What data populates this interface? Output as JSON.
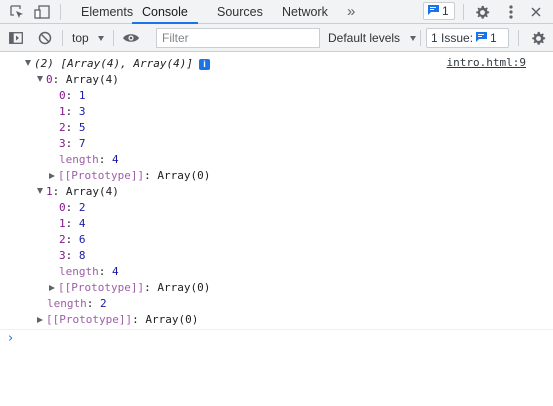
{
  "topbar": {
    "tabs": [
      {
        "label": "Elements",
        "active": false
      },
      {
        "label": "Console",
        "active": true
      },
      {
        "label": "Sources",
        "active": false
      },
      {
        "label": "Network",
        "active": false
      }
    ],
    "more_tabs_glyph": "»",
    "messages_count": "1",
    "icons": [
      "inspect-element-icon",
      "device-toggle-icon",
      "more-tabs-icon",
      "message-icon",
      "settings-icon",
      "kebab-menu-icon"
    ]
  },
  "toolbar": {
    "context": "top",
    "filter_placeholder": "Filter",
    "levels": "Default levels",
    "issues_label": "1 Issue:",
    "issues_count": "1"
  },
  "console": {
    "source": "intro.html:9",
    "root_summary": "(2) [Array(4), Array(4)]",
    "info_glyph": "i",
    "arrays": [
      {
        "label": "0",
        "type": "Array(4)",
        "items": [
          {
            "index": "0",
            "value": "1"
          },
          {
            "index": "1",
            "value": "3"
          },
          {
            "index": "2",
            "value": "5"
          },
          {
            "index": "3",
            "value": "7"
          }
        ],
        "length_key": "length",
        "length": "4",
        "proto_key": "[[Prototype]]",
        "proto_value": "Array(0)"
      },
      {
        "label": "1",
        "type": "Array(4)",
        "items": [
          {
            "index": "0",
            "value": "2"
          },
          {
            "index": "1",
            "value": "4"
          },
          {
            "index": "2",
            "value": "6"
          },
          {
            "index": "3",
            "value": "8"
          }
        ],
        "length_key": "length",
        "length": "4",
        "proto_key": "[[Prototype]]",
        "proto_value": "Array(0)"
      }
    ],
    "root_length_key": "length",
    "root_length": "2",
    "root_proto_key": "[[Prototype]]",
    "root_proto_value": "Array(0)",
    "prompt_glyph": "›"
  }
}
